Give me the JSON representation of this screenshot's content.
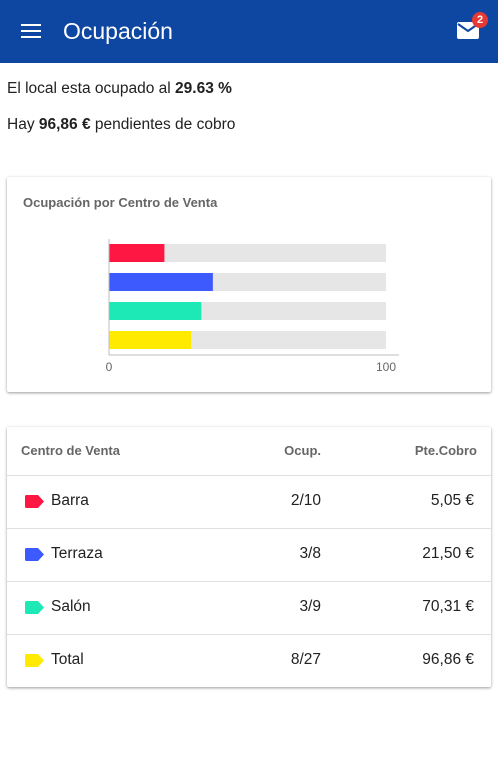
{
  "appbar": {
    "title": "Ocupación",
    "menu_icon": "menu-icon",
    "mail_icon": "mail-icon",
    "mail_badge": "2",
    "color": "#0d47a1"
  },
  "summary": {
    "occupancy_prefix": "El local esta ocupado al ",
    "occupancy_value": "29.63 %",
    "pending_prefix": "Hay ",
    "pending_value": "96,86 €",
    "pending_suffix": " pendientes de cobro"
  },
  "chart_data": {
    "type": "bar",
    "orientation": "horizontal",
    "title": "Ocupación por Centro de Venta",
    "categories": [
      "Barra",
      "Terraza",
      "Salón",
      "Total"
    ],
    "values": [
      20,
      37.5,
      33.33,
      29.63
    ],
    "max": 100,
    "colors": [
      "#ff1744",
      "#3d5afe",
      "#1de9b6",
      "#ffea00"
    ],
    "background_color": "#e6e6e6",
    "xlim": [
      0,
      100
    ],
    "tick_labels": [
      "0",
      "100"
    ]
  },
  "table": {
    "headers": {
      "centro": "Centro de Venta",
      "ocup": "Ocup.",
      "pte": "Pte.Cobro"
    },
    "rows": [
      {
        "name": "Barra",
        "ocup": "2/10",
        "pte": "5,05 €",
        "color": "#ff1744",
        "icon": "tag-icon"
      },
      {
        "name": "Terraza",
        "ocup": "3/8",
        "pte": "21,50 €",
        "color": "#3d5afe",
        "icon": "tag-icon"
      },
      {
        "name": "Salón",
        "ocup": "3/9",
        "pte": "70,31 €",
        "color": "#1de9b6",
        "icon": "tag-icon"
      },
      {
        "name": "Total",
        "ocup": "8/27",
        "pte": "96,86 €",
        "color": "#ffea00",
        "icon": "tag-icon"
      }
    ]
  }
}
